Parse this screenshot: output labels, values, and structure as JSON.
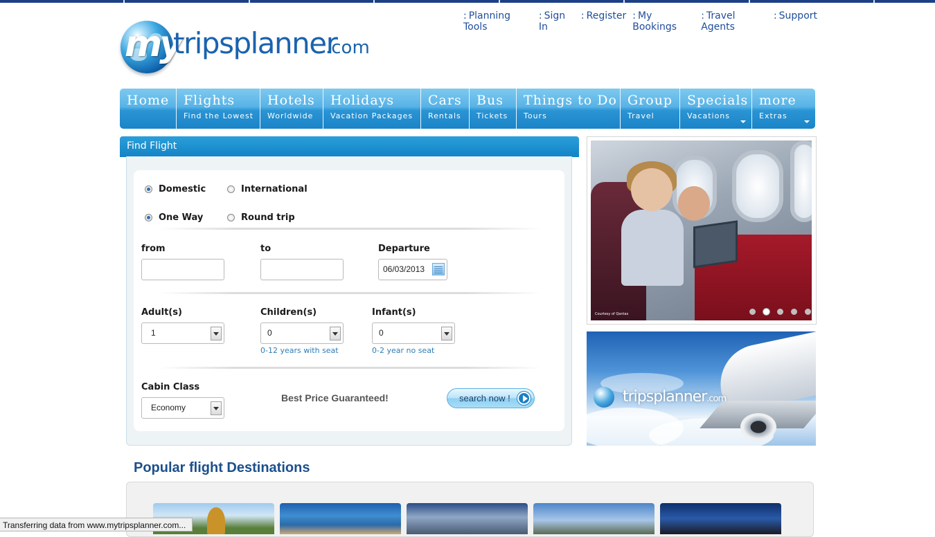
{
  "top_links": [
    {
      "label": "Planning Tools"
    },
    {
      "label": "Sign In"
    },
    {
      "label": "Register"
    },
    {
      "label": "My Bookings"
    },
    {
      "label": "Travel Agents"
    },
    {
      "label": "Support"
    }
  ],
  "logo": {
    "my": "my",
    "main": "tripsplanner",
    "tld": ".com"
  },
  "nav": [
    {
      "label": "Home",
      "sub": ""
    },
    {
      "label": "Flights",
      "sub": "Find the Lowest"
    },
    {
      "label": "Hotels",
      "sub": "Worldwide"
    },
    {
      "label": "Holidays",
      "sub": "Vacation Packages"
    },
    {
      "label": "Cars",
      "sub": "Rentals"
    },
    {
      "label": "Bus",
      "sub": "Tickets"
    },
    {
      "label": "Things to Do",
      "sub": "Tours"
    },
    {
      "label": "Group",
      "sub": "Travel"
    },
    {
      "label": "Specials",
      "sub": "Vacations"
    },
    {
      "label": "more",
      "sub": "Extras"
    }
  ],
  "find_flight": {
    "title": "Find Flight",
    "trip_scope": {
      "domestic": "Domestic",
      "international": "International",
      "selected": "Domestic"
    },
    "trip_type": {
      "one_way": "One Way",
      "round_trip": "Round trip",
      "selected": "One Way"
    },
    "from_label": "from",
    "from_value": "",
    "to_label": "to",
    "to_value": "",
    "departure_label": "Departure",
    "departure_value": "06/03/2013",
    "adults_label": "Adult(s)",
    "adults_value": "1",
    "children_label": "Children(s)",
    "children_value": "0",
    "children_hint": "0-12 years with seat",
    "infants_label": "Infant(s)",
    "infants_value": "0",
    "infants_hint": "0-2 year no seat",
    "cabin_label": "Cabin Class",
    "cabin_value": "Economy",
    "best_price": "Best Price Guaranteed!",
    "search_label": "search now !"
  },
  "slideshow": {
    "credit": "Courtesy of Qantas",
    "dots": 5,
    "active_dot": 2
  },
  "promo": {
    "brand_main": "tripsplanner",
    "brand_tld": ".com"
  },
  "popular": {
    "title": "Popular flight Destinations"
  },
  "status_bar": "Transferring data from www.mytripsplanner.com..."
}
